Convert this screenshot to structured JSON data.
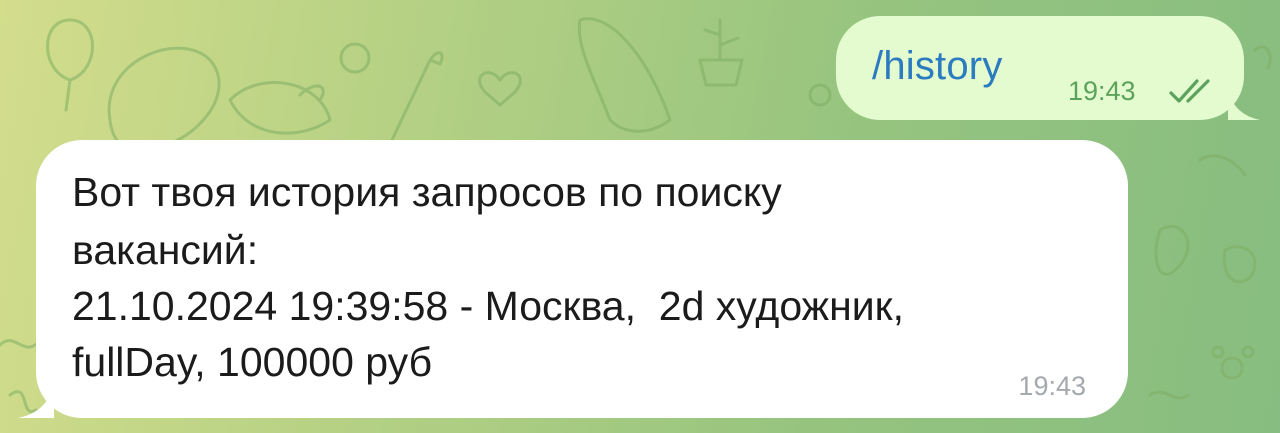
{
  "outgoing_message": {
    "text": "/history",
    "time": "19:43",
    "status_icon": "double-check-icon"
  },
  "incoming_message": {
    "lines": [
      "Вот твоя история запросов по поиску",
      "вакансий:",
      "21.10.2024 19:39:58 - Москва,  2d художник,",
      "fullDay, 100000 руб"
    ],
    "time": "19:43"
  },
  "colors": {
    "outgoing_bubble": "#e3fbcf",
    "incoming_bubble": "#ffffff",
    "command_link": "#2a7bbf",
    "read_check": "#5da25c",
    "timestamp_incoming": "#a4a9ae"
  }
}
